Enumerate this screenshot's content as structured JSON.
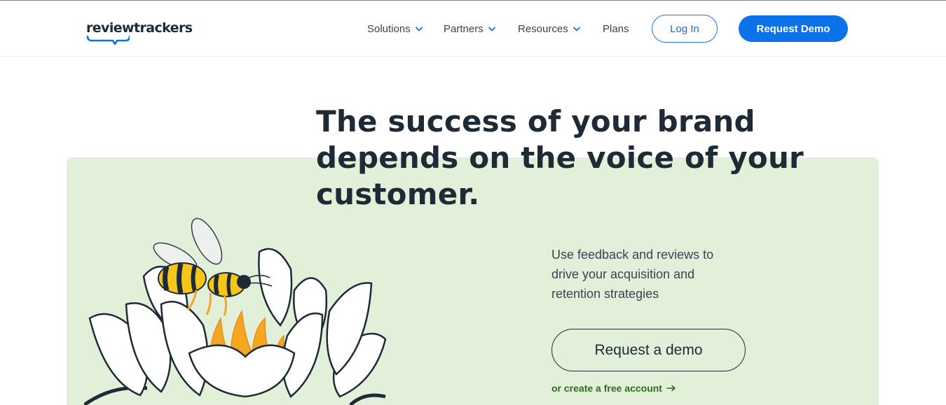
{
  "header": {
    "logo_text": "reviewtrackers",
    "nav": [
      {
        "label": "Solutions",
        "has_dropdown": true
      },
      {
        "label": "Partners",
        "has_dropdown": true
      },
      {
        "label": "Resources",
        "has_dropdown": true
      },
      {
        "label": "Plans",
        "has_dropdown": false
      }
    ],
    "login_label": "Log In",
    "demo_label": "Request Demo"
  },
  "hero": {
    "headline_line1": "The success of your brand",
    "headline_line2": "depends on the voice of your",
    "headline_line3": "customer.",
    "subtext_line1": "Use feedback and reviews to",
    "subtext_line2": "drive your acquisition and",
    "subtext_line3": "retention strategies",
    "cta_label": "Request a demo",
    "secondary_link": "or create a free account"
  },
  "colors": {
    "brand_blue": "#0b72e7",
    "hero_bg": "#e2f0d9",
    "link_green": "#2f6b1f",
    "text_dark": "#1f2a37"
  }
}
